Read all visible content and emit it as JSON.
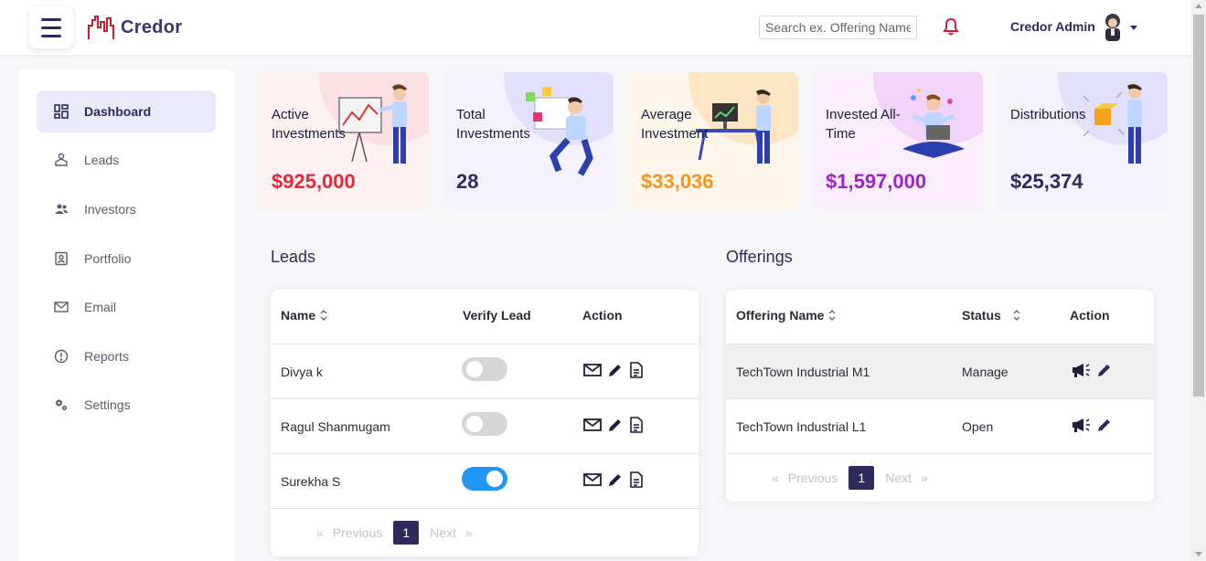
{
  "header": {
    "brand": "Credor",
    "search_placeholder": "Search ex. Offering Name",
    "user_name": "Credor Admin"
  },
  "sidebar": {
    "items": [
      {
        "label": "Dashboard",
        "icon": "dashboard-icon",
        "active": true
      },
      {
        "label": "Leads",
        "icon": "leads-icon"
      },
      {
        "label": "Investors",
        "icon": "investors-icon"
      },
      {
        "label": "Portfolio",
        "icon": "portfolio-icon"
      },
      {
        "label": "Email",
        "icon": "email-icon"
      },
      {
        "label": "Reports",
        "icon": "reports-icon"
      },
      {
        "label": "Settings",
        "icon": "settings-icon"
      }
    ]
  },
  "stats": [
    {
      "label": "Active Investments",
      "value": "$925,000",
      "color": "#e8283a",
      "bg": "#fdf1f2",
      "blob": "#fcdfe2"
    },
    {
      "label": "Total Investments",
      "value": "28",
      "color": "#2e2a5c",
      "bg": "#f4f3fd",
      "blob": "#e3e0fb"
    },
    {
      "label": "Average Investment",
      "value": "$33,036",
      "color": "#f7931e",
      "bg": "#fef6ea",
      "blob": "#fde6c6"
    },
    {
      "label": "Invested All-Time",
      "value": "$1,597,000",
      "color": "#a322c9",
      "bg": "#faeefc",
      "blob": "#f2d3fa"
    },
    {
      "label": "Distributions",
      "value": "$25,374",
      "color": "#2e2a5c",
      "bg": "#f4f3fd",
      "blob": "#e3e0fb"
    }
  ],
  "leads": {
    "title": "Leads",
    "columns": [
      "Name",
      "Verify Lead",
      "Action"
    ],
    "rows": [
      {
        "name": "Divya k",
        "verified": false
      },
      {
        "name": "Ragul Shanmugam",
        "verified": false
      },
      {
        "name": "Surekha S",
        "verified": true
      }
    ],
    "pager": {
      "prev": "Previous",
      "page": "1",
      "next": "Next",
      "first": "«",
      "last": "»"
    }
  },
  "offerings": {
    "title": "Offerings",
    "columns": [
      "Offering Name",
      "Status",
      "Action"
    ],
    "rows": [
      {
        "name": "TechTown Industrial M1",
        "status": "Manage"
      },
      {
        "name": "TechTown Industrial L1",
        "status": "Open"
      }
    ],
    "pager": {
      "prev": "Previous",
      "page": "1",
      "next": "Next",
      "first": "«",
      "last": "»"
    }
  }
}
